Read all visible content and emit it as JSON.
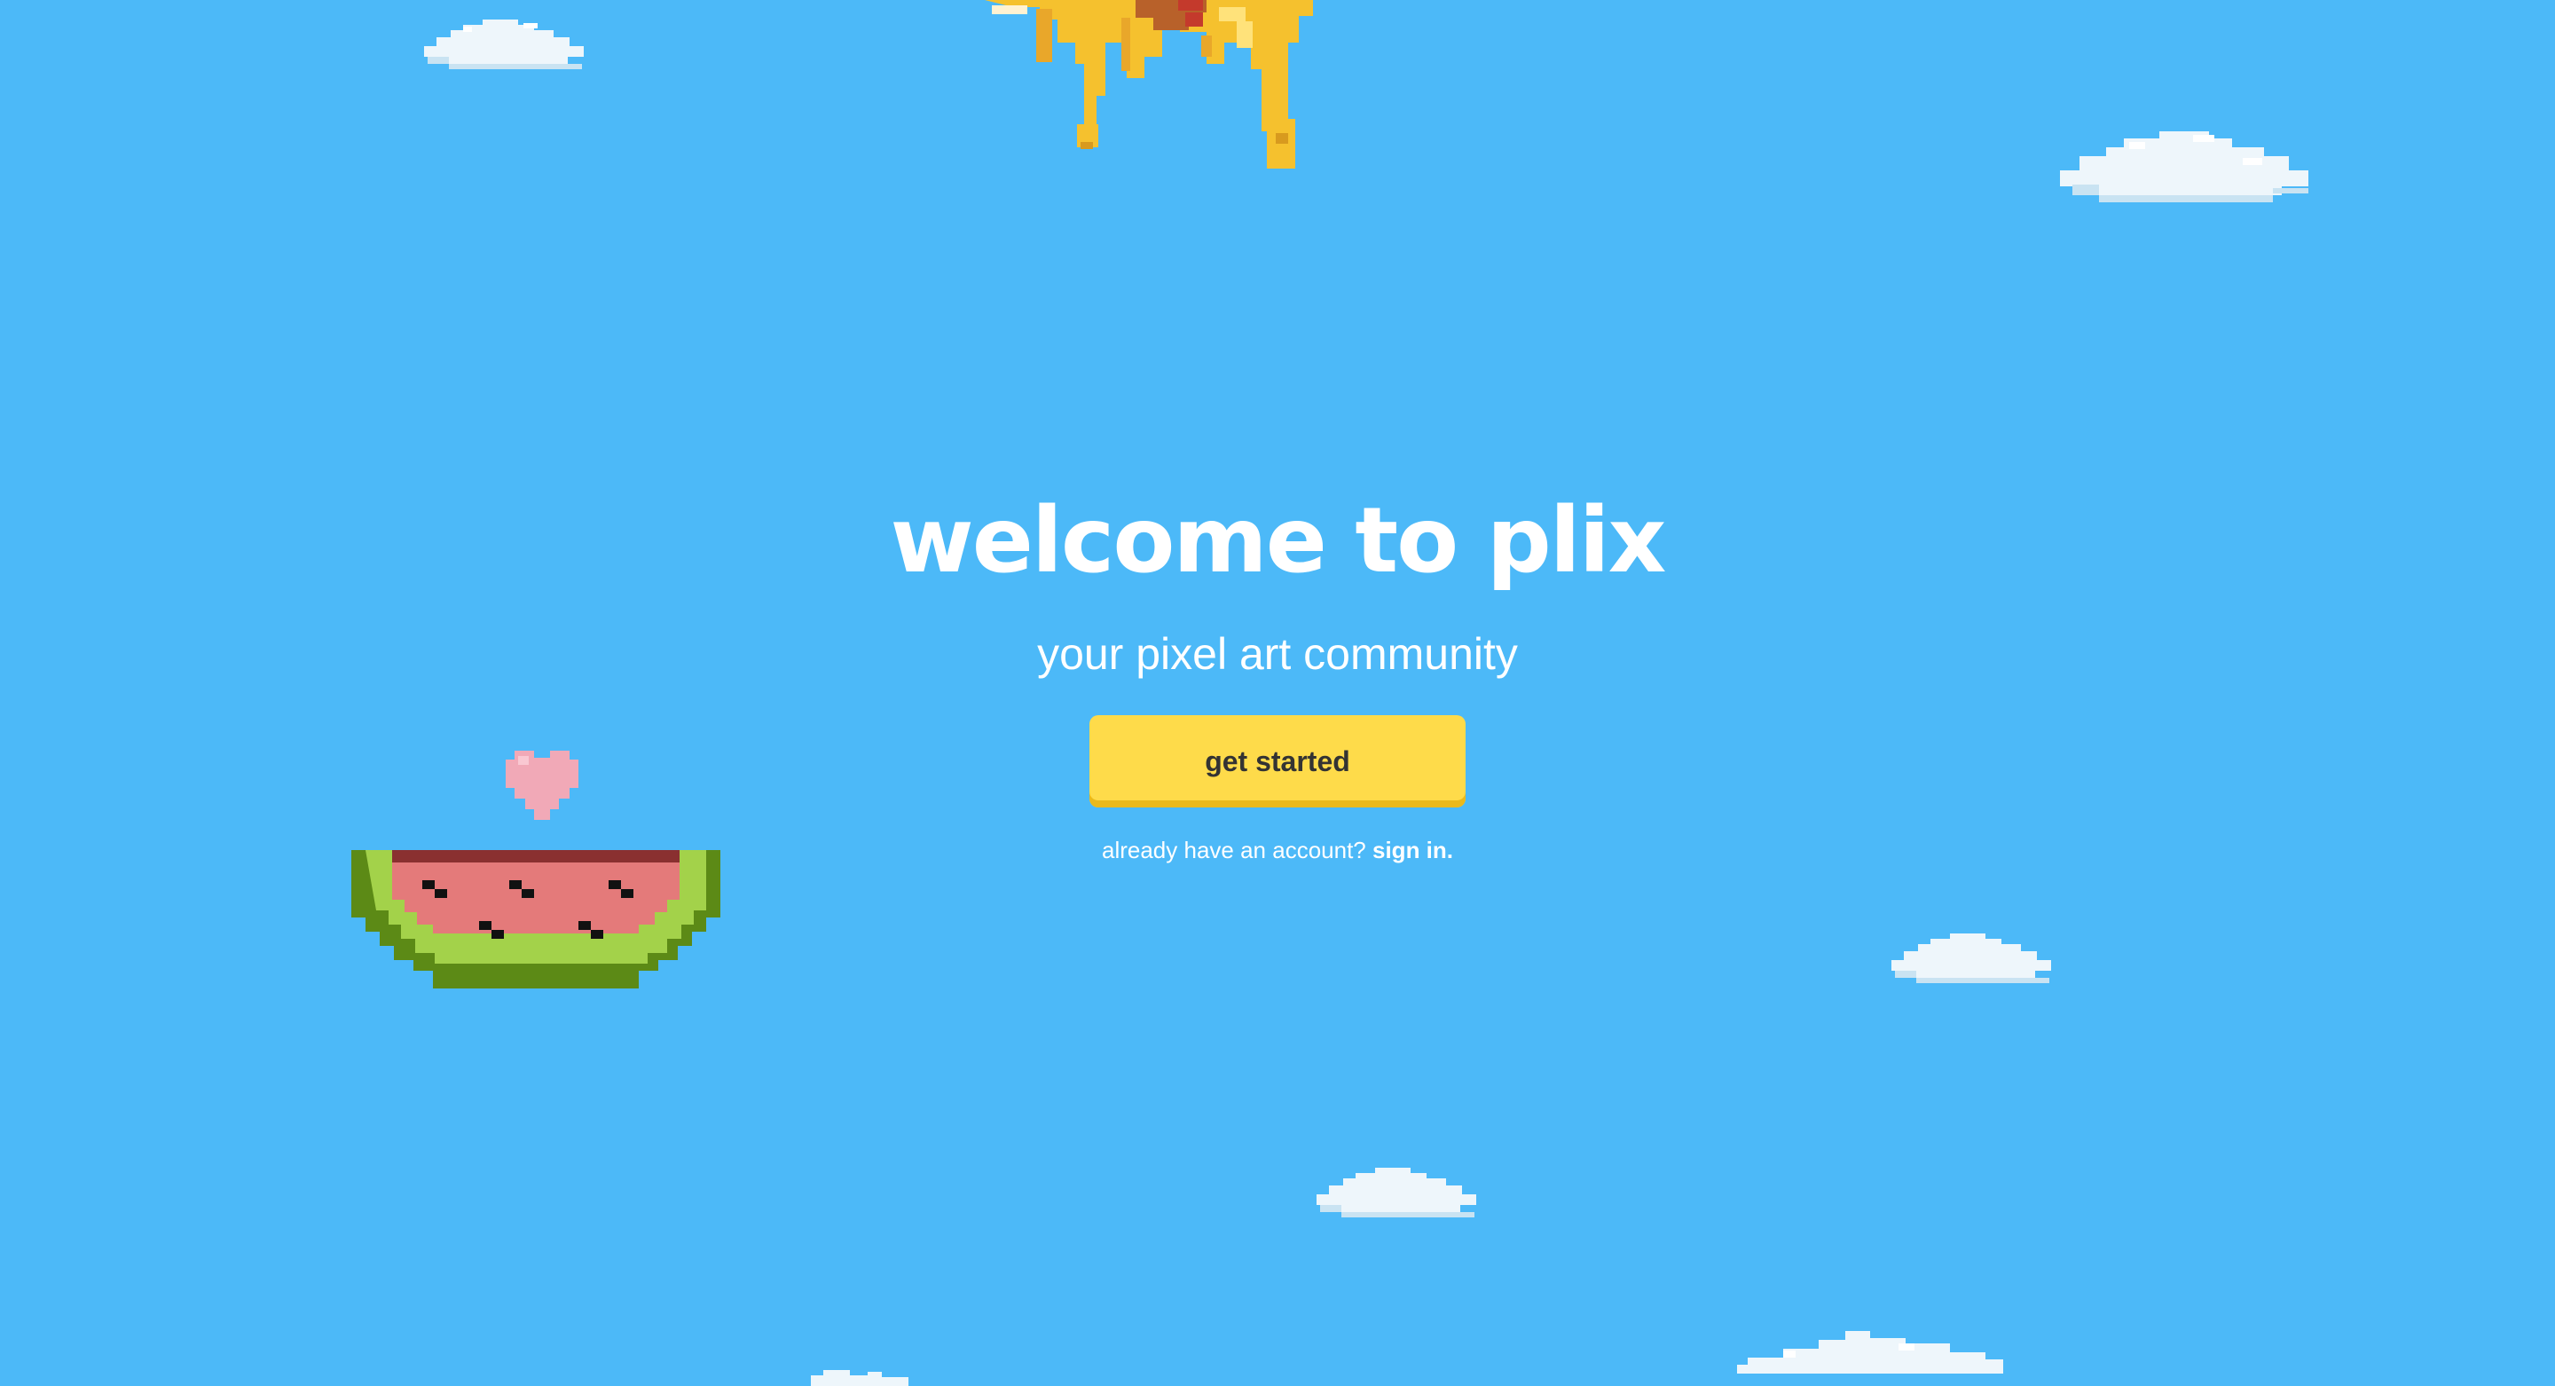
{
  "hero": {
    "title": "welcome to plix",
    "subtitle": "your pixel art community",
    "cta_label": "get started",
    "signin_prompt": "already have an account?",
    "signin_link": "sign in."
  },
  "decorations": {
    "top_sprite": "melting-pizza-pixel-art",
    "heart": "pink-heart-pixel-icon",
    "watermelon": "watermelon-slice-pixel-art",
    "clouds": "pixel-cloud"
  },
  "colors": {
    "background": "#4cb9f8",
    "cta_background": "#fedb4a",
    "cta_text": "#333333",
    "text": "#ffffff"
  }
}
